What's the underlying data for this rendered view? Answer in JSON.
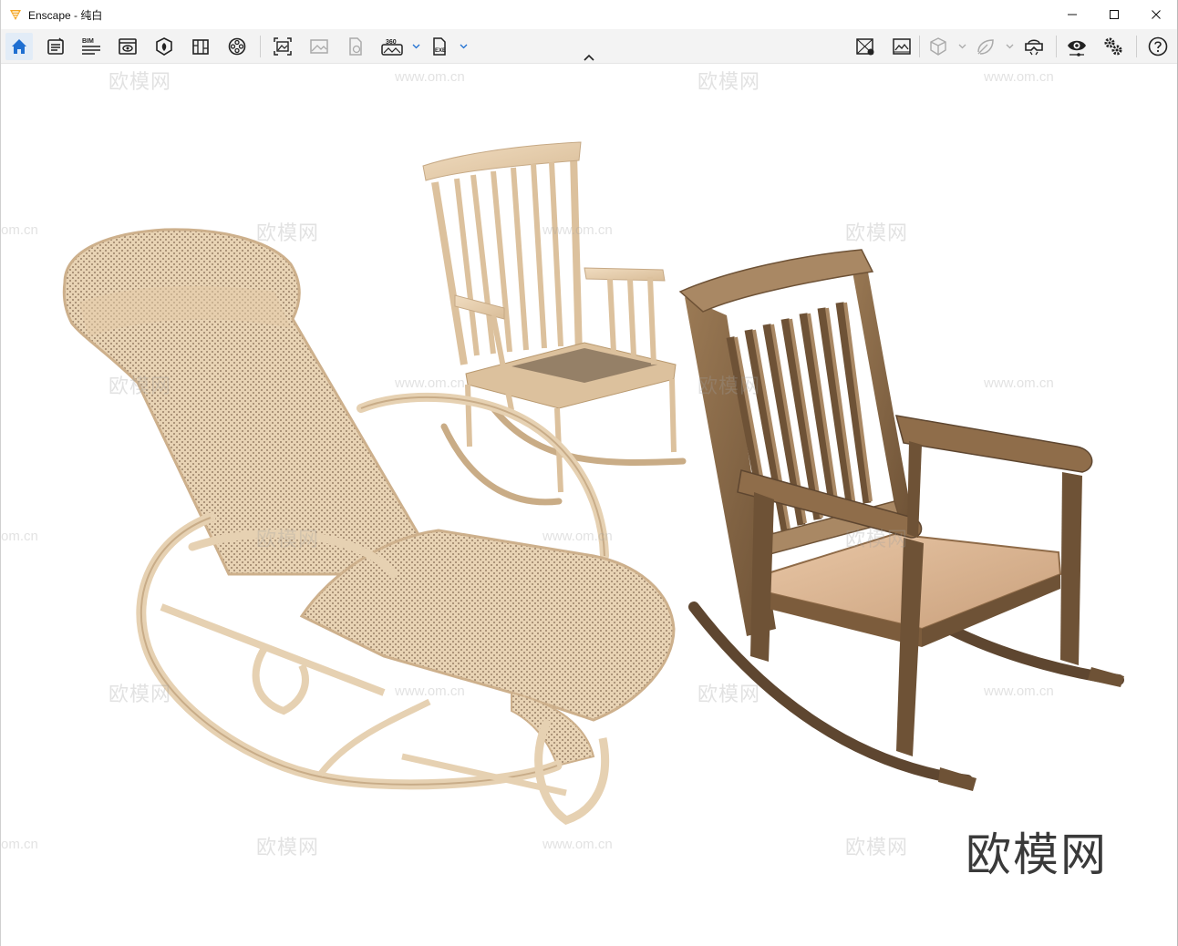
{
  "window": {
    "title": "Enscape - 纯白",
    "accent": "#1f6fd1",
    "logo_color": "#f5a623"
  },
  "window_controls": [
    "minimize-icon",
    "maximize-icon",
    "close-icon"
  ],
  "toolbar": {
    "left_tools": [
      {
        "name": "home-icon",
        "active": true
      },
      {
        "name": "capture-list-icon"
      },
      {
        "name": "bim-info-icon",
        "label": "BIM"
      },
      {
        "name": "views-icon"
      },
      {
        "name": "asset-library-icon"
      },
      {
        "name": "material-editor-icon"
      },
      {
        "name": "video-editor-icon"
      },
      {
        "name": "screenshot-icon"
      },
      {
        "name": "batch-render-icon"
      },
      {
        "name": "web-standalone-icon"
      },
      {
        "name": "panorama-360-icon",
        "label": "360",
        "dropdown": true
      },
      {
        "name": "exe-export-icon",
        "label": "EXE",
        "dropdown": true
      }
    ],
    "right_tools": [
      {
        "name": "vr-toggle-icon"
      },
      {
        "name": "map-icon"
      },
      {
        "name": "orthographic-cube-icon",
        "dropdown": true
      },
      {
        "name": "atmosphere-icon",
        "dropdown": true
      },
      {
        "name": "vr-headset-icon"
      },
      {
        "name": "visual-settings-eye-icon"
      },
      {
        "name": "settings-gears-icon"
      },
      {
        "name": "help-icon"
      }
    ]
  },
  "viewport": {
    "watermark_text": "欧模网",
    "watermark_url": "www.om.cn",
    "watermark_url_clipped": "om.cn",
    "brand_mark": "欧模网",
    "objects": [
      "rattan-lounge-rocking-chair",
      "spindle-back-rocking-chair",
      "dark-wood-rocking-chair"
    ]
  }
}
